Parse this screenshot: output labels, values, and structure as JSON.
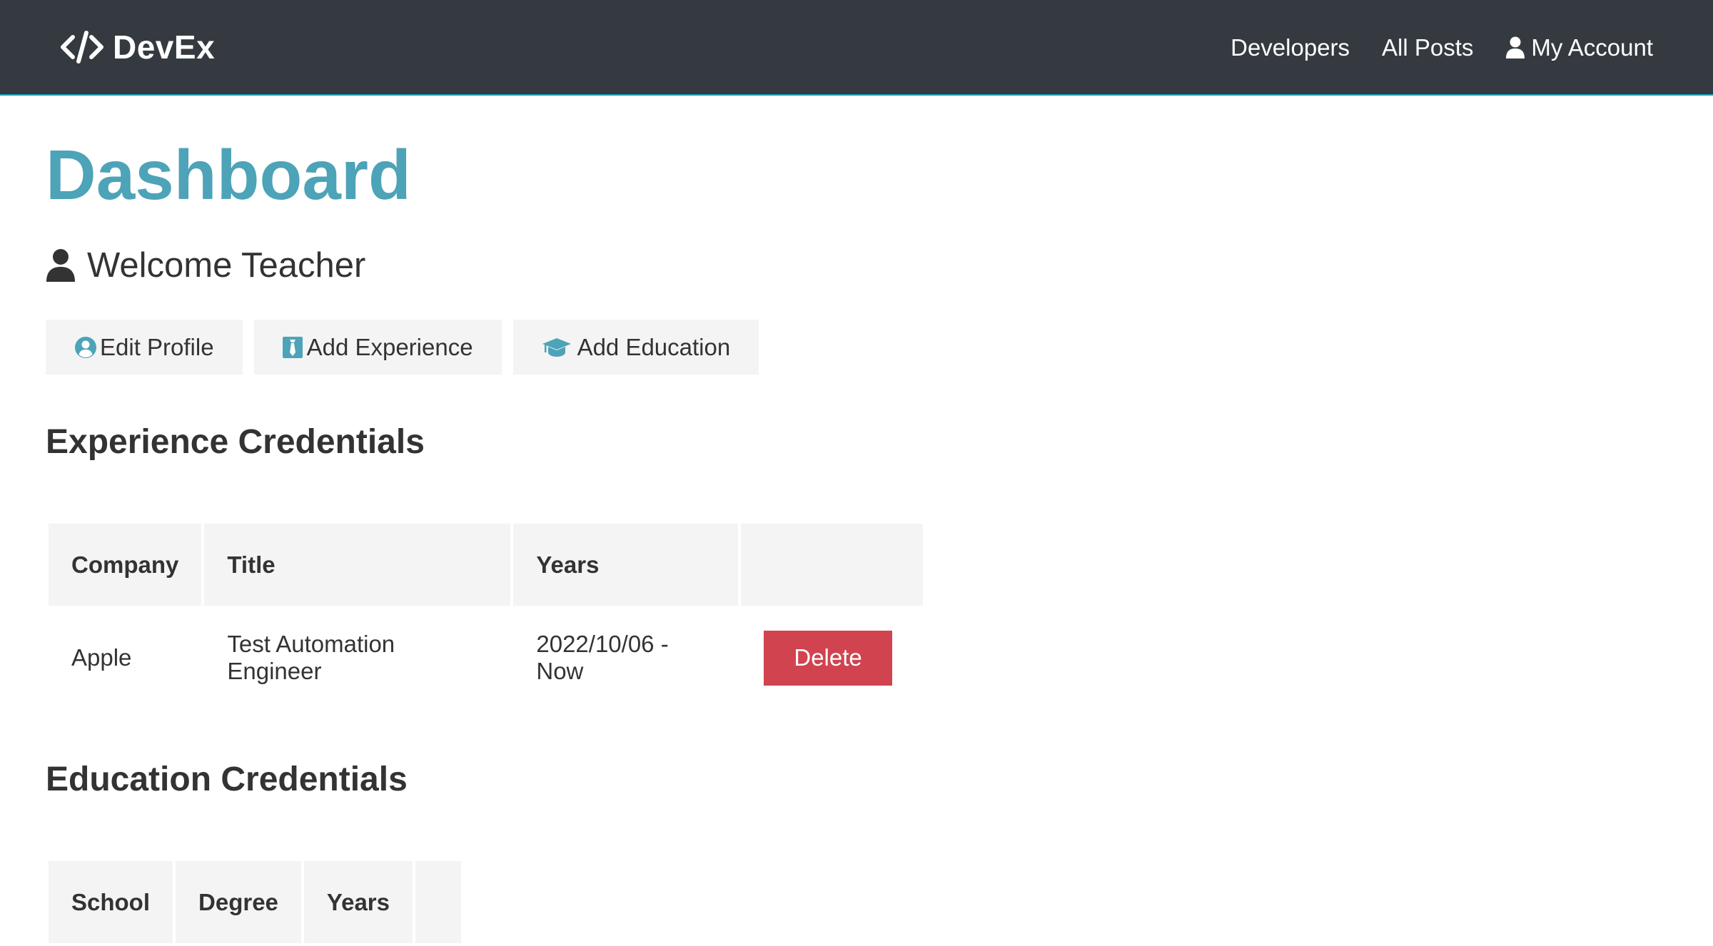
{
  "navbar": {
    "brand": "DevEx",
    "links": [
      {
        "label": "Developers"
      },
      {
        "label": "All Posts"
      },
      {
        "label": "My Account",
        "icon": "user-icon"
      }
    ]
  },
  "page": {
    "title": "Dashboard",
    "welcome": "Welcome Teacher"
  },
  "actions": {
    "edit_profile": "Edit Profile",
    "add_experience": "Add Experience",
    "add_education": "Add Education"
  },
  "experience": {
    "heading": "Experience Credentials",
    "columns": [
      "Company",
      "Title",
      "Years",
      ""
    ],
    "rows": [
      {
        "company": "Apple",
        "title": "Test Automation Engineer",
        "years": "2022/10/06 - Now",
        "action": "Delete"
      }
    ]
  },
  "education": {
    "heading": "Education Credentials",
    "columns": [
      "School",
      "Degree",
      "Years",
      ""
    ],
    "rows": []
  },
  "colors": {
    "navbar_bg": "#343a40",
    "accent": "#4da3b8",
    "danger": "#d1434f",
    "light_bg": "#f4f4f4"
  }
}
